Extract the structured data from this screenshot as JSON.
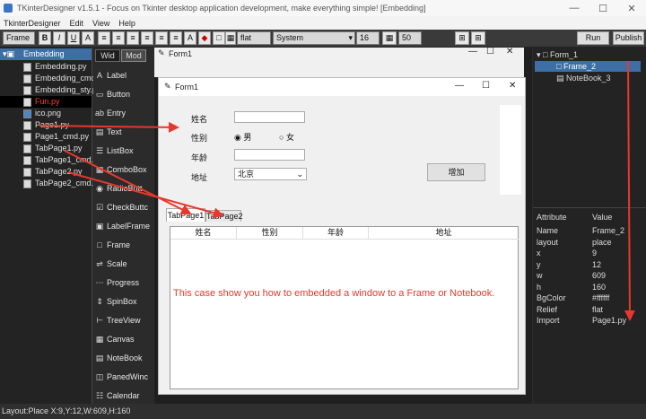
{
  "window": {
    "title": "TKinterDesigner v1.5.1 - Focus on Tkinter desktop application development, make everything simple!    [Embedding]"
  },
  "menubar": {
    "items": [
      "TkinterDesigner",
      "Edit",
      "View",
      "Help"
    ]
  },
  "toolbar": {
    "frame_label": "Frame",
    "bold": "B",
    "italic": "I",
    "underline": "U",
    "text_a": "A",
    "relief": "flat",
    "font": "System",
    "size": "16",
    "percent": "50",
    "run": "Run",
    "publish": "Publish"
  },
  "files": {
    "root": "Embedding",
    "items": [
      "Embedding.py",
      "Embedding_cmd.p",
      "Embedding_sty.p",
      "Fun.py",
      "ico.png",
      "Page1.py",
      "Page1_cmd.py",
      "TabPage1.py",
      "TabPage1_cmd.p",
      "TabPage2.py",
      "TabPage2_cmd.p"
    ]
  },
  "widgets": {
    "tabs": [
      "Wid",
      "Mod"
    ],
    "items": [
      "Label",
      "Button",
      "Entry",
      "Text",
      "ListBox",
      "ComboBox",
      "RadioButt",
      "CheckButtc",
      "LabelFrame",
      "Frame",
      "Scale",
      "Progress",
      "SpinBox",
      "TreeView",
      "Canvas",
      "NoteBook",
      "PanedWinc",
      "Calendar"
    ]
  },
  "form1": {
    "title": "Form1"
  },
  "form2": {
    "title": "Form1",
    "labels": {
      "name": "姓名",
      "gender": "性别",
      "age": "年龄",
      "address": "地址"
    },
    "radio": {
      "male": "男",
      "female": "女"
    },
    "combo_value": "北京",
    "add_button": "增加",
    "tabs": [
      "TabPage1",
      "TabPage2"
    ],
    "table_headers": [
      "姓名",
      "性别",
      "年龄",
      "地址"
    ],
    "message": "This case show you how to embedded a window to a Frame or Notebook."
  },
  "tree": {
    "items": [
      "Form_1",
      "Frame_2",
      "NoteBook_3"
    ]
  },
  "properties": {
    "header": [
      "Attribute",
      "Value"
    ],
    "rows": [
      [
        "Name",
        "Frame_2"
      ],
      [
        "layout",
        "place"
      ],
      [
        "x",
        "9"
      ],
      [
        "y",
        "12"
      ],
      [
        "w",
        "609"
      ],
      [
        "h",
        "160"
      ],
      [
        "BgColor",
        "#ffffff"
      ],
      [
        "Relief",
        "flat"
      ],
      [
        "Import",
        "Page1.py"
      ]
    ]
  },
  "status": {
    "text": "Layout:Place  X:9,Y:12,W:609,H:160"
  },
  "colors": {
    "accent": "#e8382c",
    "selection": "#3d6fa5"
  }
}
